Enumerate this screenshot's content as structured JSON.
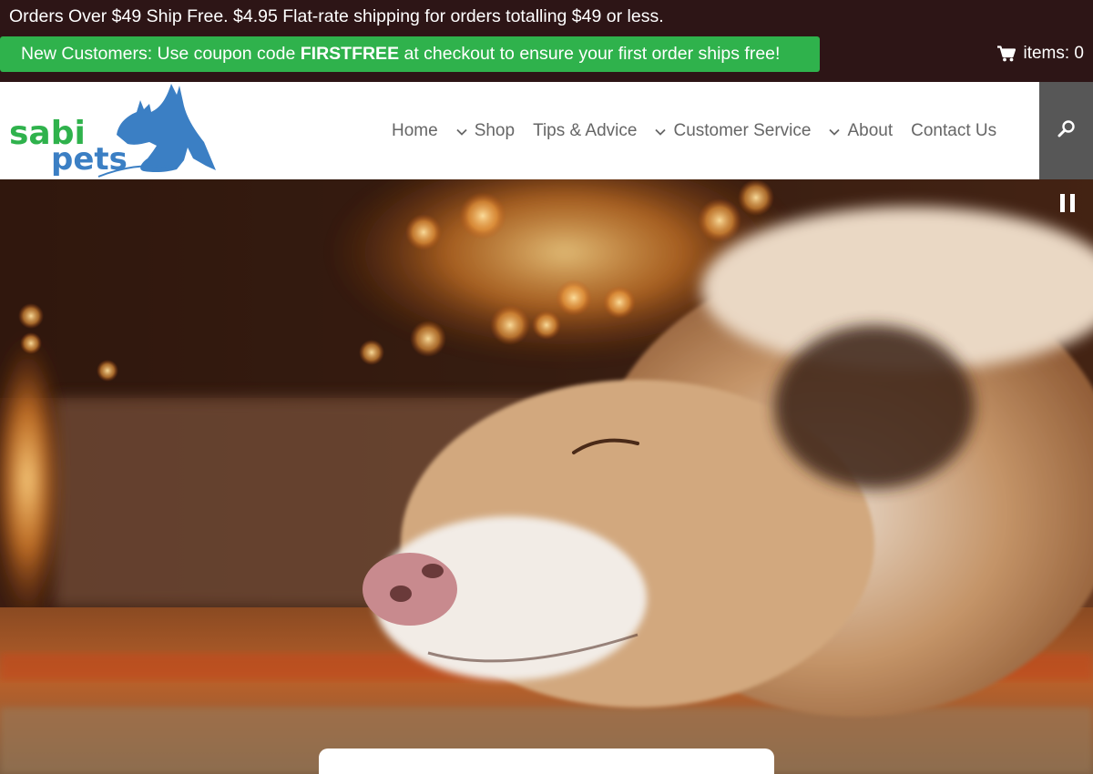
{
  "topbar": {
    "shipping_text": "Orders Over $49 Ship Free. $4.95 Flat-rate shipping for orders totalling $49 or less.",
    "coupon": {
      "prefix": "New Customers: Use coupon code ",
      "code": "FIRSTFREE",
      "suffix": " at checkout to ensure your first order ships free!"
    },
    "cart_label": "items: 0",
    "cart_icon": "shopping-cart-icon"
  },
  "logo": {
    "word1": "sabi",
    "word2": "pets",
    "icon": "dog-cat-silhouette"
  },
  "nav": {
    "items": [
      {
        "label": "Home",
        "dropdown": false
      },
      {
        "label": "Shop",
        "dropdown": true
      },
      {
        "label": "Tips & Advice",
        "dropdown": false
      },
      {
        "label": "Customer Service",
        "dropdown": true
      },
      {
        "label": "About",
        "dropdown": true
      },
      {
        "label": "Contact Us",
        "dropdown": false
      }
    ],
    "search_icon": "search-icon"
  },
  "hero": {
    "image_subject": "dog sleeping by fireplace",
    "pause_icon": "pause-icon"
  },
  "colors": {
    "topbar_bg": "#2d1516",
    "coupon_bg": "#2fb24c",
    "logo_green": "#2fb24c",
    "logo_blue": "#3b7fc4",
    "nav_text": "#666666",
    "search_bg": "#575757"
  }
}
